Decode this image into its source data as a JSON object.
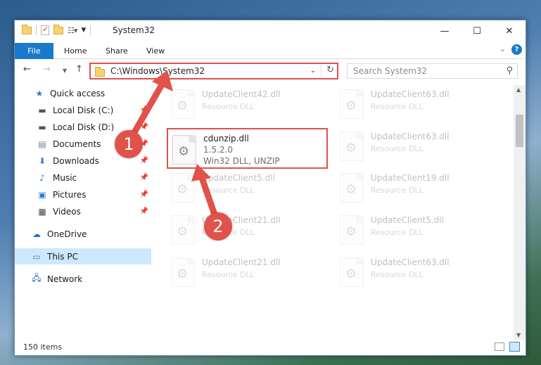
{
  "window": {
    "title": "System32",
    "controls": {
      "minimize": "—",
      "maximize": "☐",
      "close": "✕"
    }
  },
  "ribbon": {
    "tabs": [
      "File",
      "Home",
      "Share",
      "View"
    ]
  },
  "navbar": {
    "address": "C:\\Windows\\System32",
    "search_placeholder": "Search System32"
  },
  "sidebar": {
    "items": [
      {
        "label": "Quick access",
        "icon": "star-icon",
        "pinned": false
      },
      {
        "label": "Local Disk (C:)",
        "icon": "drive-icon",
        "pinned": true
      },
      {
        "label": "Local Disk (D:)",
        "icon": "drive-icon",
        "pinned": true
      },
      {
        "label": "Documents",
        "icon": "documents-icon",
        "pinned": true
      },
      {
        "label": "Downloads",
        "icon": "download-icon",
        "pinned": true
      },
      {
        "label": "Music",
        "icon": "music-icon",
        "pinned": true
      },
      {
        "label": "Pictures",
        "icon": "pictures-icon",
        "pinned": true
      },
      {
        "label": "Videos",
        "icon": "videos-icon",
        "pinned": true
      },
      {
        "label": "OneDrive",
        "icon": "cloud-icon",
        "pinned": false
      },
      {
        "label": "This PC",
        "icon": "computer-icon",
        "pinned": false,
        "selected": true
      },
      {
        "label": "Network",
        "icon": "network-icon",
        "pinned": false
      }
    ]
  },
  "files": {
    "left_column": [
      {
        "name": "UpdateClient42.dll",
        "desc": "Resource DLL"
      },
      {
        "name": "UpdateClient5.dll",
        "desc": "Resource DLL"
      },
      {
        "name": "UpdateClient21.dll",
        "desc": "Resource DLL"
      },
      {
        "name": "UpdateClient21.dll",
        "desc": "Resource DLL"
      }
    ],
    "right_column": [
      {
        "name": "UpdateClient63.dll",
        "desc": "Resource DLL"
      },
      {
        "name": "UpdateClient63.dll",
        "desc": "Resource DLL"
      },
      {
        "name": "UpdateClient19.dll",
        "desc": "Resource DLL"
      },
      {
        "name": "UpdateClient5.dll",
        "desc": "Resource DLL"
      },
      {
        "name": "UpdateClient63.dll",
        "desc": "Resource DLL"
      }
    ],
    "highlighted": {
      "name": "cdunzip.dll",
      "version": "1.5.2.0",
      "desc": "Win32 DLL, UNZIP"
    }
  },
  "status": {
    "item_count": "150 items"
  },
  "annotations": {
    "badge_1": "1",
    "badge_2": "2",
    "color": "#e0524a"
  }
}
